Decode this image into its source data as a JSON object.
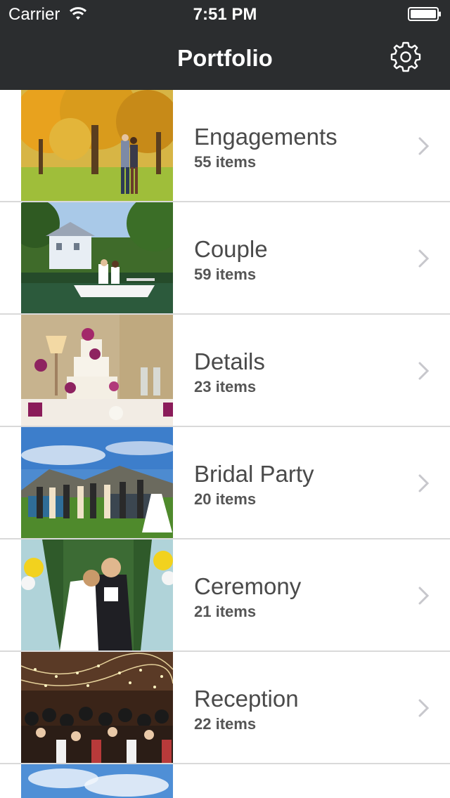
{
  "status_bar": {
    "carrier": "Carrier",
    "time": "7:51 PM"
  },
  "nav": {
    "title": "Portfolio",
    "settings_icon": "gear-icon"
  },
  "items": [
    {
      "title": "Engagements",
      "count": "55 items",
      "image": "couple under autumn tree"
    },
    {
      "title": "Couple",
      "count": "59 items",
      "image": "couple kissing in rowboat"
    },
    {
      "title": "Details",
      "count": "23 items",
      "image": "wedding cake with flowers"
    },
    {
      "title": "Bridal Party",
      "count": "20 items",
      "image": "bridal party by vintage truck"
    },
    {
      "title": "Ceremony",
      "count": "21 items",
      "image": "couple kissing at altar"
    },
    {
      "title": "Reception",
      "count": "22 items",
      "image": "crowded reception dance floor"
    }
  ],
  "colors": {
    "bar_background": "#2b2d2f",
    "title_text": "#4a4a4a",
    "count_text": "#555555",
    "separator": "#d9d9d9",
    "chevron": "#c7c7cc"
  }
}
